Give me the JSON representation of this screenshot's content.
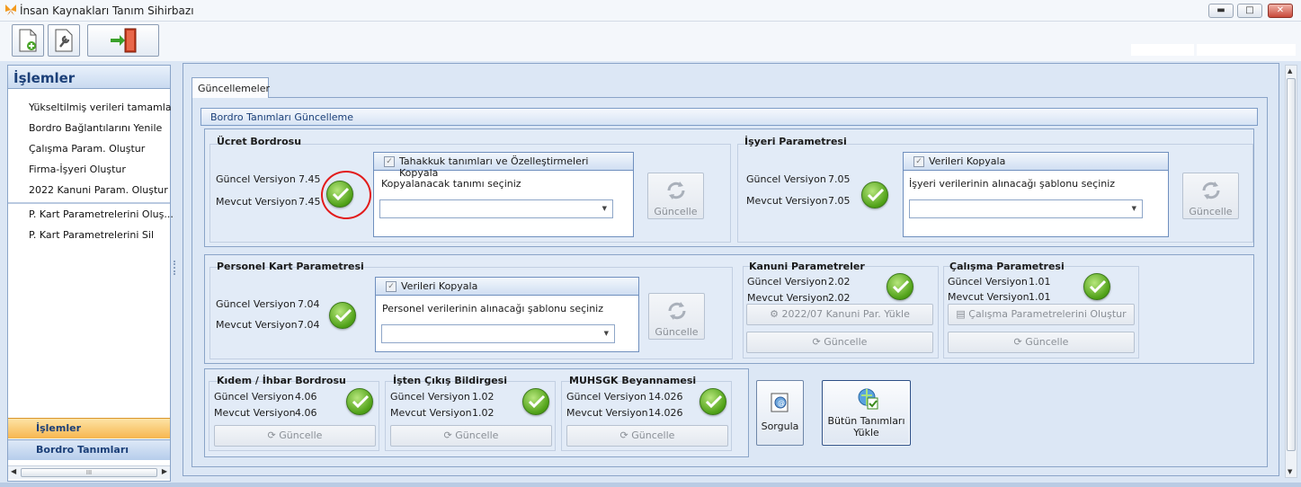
{
  "window": {
    "title": "İnsan Kaynakları Tanım Sihirbazı",
    "minimize": "▬",
    "maximize": "□",
    "close": "✕"
  },
  "toolbar": {
    "items": [
      "new-document-icon",
      "settings-wrench-icon",
      "exit-door-icon"
    ]
  },
  "sidebar": {
    "title": "İşlemler",
    "items": [
      "Yükseltilmiş verileri tamamla",
      "Bordro Bağlantılarını Yenile",
      "Çalışma Param. Oluştur",
      "Firma-İşyeri Oluştur",
      "2022 Kanuni Param. Oluştur"
    ],
    "items2": [
      "P. Kart Parametrelerini Oluş...",
      "P. Kart Parametrelerini Sil"
    ],
    "tab_active": "İşlemler",
    "tab_other": "Bordro Tanımları",
    "scroll_grip": "III"
  },
  "main": {
    "tab": "Güncellemeler",
    "group_title": "Bordro Tanımları Güncelleme",
    "ucret": {
      "title": "Ücret Bordrosu",
      "guncel_label": "Güncel Versiyon",
      "guncel": "7.45",
      "mevcut_label": "Mevcut Versiyon",
      "mevcut": "7.45",
      "copy_label": "Tahakkuk tanımları ve Özelleştirmeleri Kopyala",
      "select_label": "Kopyalanacak tanımı seçiniz",
      "button": "Güncelle"
    },
    "isyeri": {
      "title": "İşyeri Parametresi",
      "guncel_label": "Güncel Versiyon",
      "guncel": "7.05",
      "mevcut_label": "Mevcut Versiyon",
      "mevcut": "7.05",
      "copy_label": "Verileri Kopyala",
      "select_label": "İşyeri verilerinin alınacağı şablonu seçiniz",
      "button": "Güncelle"
    },
    "personel": {
      "title": "Personel Kart Parametresi",
      "guncel_label": "Güncel Versiyon",
      "guncel": "7.04",
      "mevcut_label": "Mevcut Versiyon",
      "mevcut": "7.04",
      "copy_label": "Verileri Kopyala",
      "select_label": "Personel verilerinin alınacağı şablonu seçiniz",
      "button": "Güncelle"
    },
    "kanuni": {
      "title": "Kanuni Parametreler",
      "guncel_label": "Güncel Versiyon",
      "guncel": "2.02",
      "mevcut_label": "Mevcut Versiyon",
      "mevcut": "2.02",
      "load_button": "2022/07 Kanuni Par. Yükle",
      "button": "Güncelle"
    },
    "calisma": {
      "title": "Çalışma Parametresi",
      "guncel_label": "Güncel Versiyon",
      "guncel": "1.01",
      "mevcut_label": "Mevcut Versiyon",
      "mevcut": "1.01",
      "create_button": "Çalışma Parametrelerini Oluştur",
      "button": "Güncelle"
    },
    "kidem": {
      "title": "Kıdem / İhbar Bordrosu",
      "guncel_label": "Güncel Versiyon",
      "guncel": "4.06",
      "mevcut_label": "Mevcut Versiyon",
      "mevcut": "4.06",
      "button": "Güncelle"
    },
    "isten": {
      "title": "İşten Çıkış Bildirgesi",
      "guncel_label": "Güncel Versiyon",
      "guncel": "1.02",
      "mevcut_label": "Mevcut Versiyon",
      "mevcut": "1.02",
      "button": "Güncelle"
    },
    "muhsgk": {
      "title": "MUHSGK Beyannamesi",
      "guncel_label": "Güncel Versiyon",
      "guncel": "14.026",
      "mevcut_label": "Mevcut Versiyon",
      "mevcut": "14.026",
      "button": "Güncelle"
    },
    "sorgula": "Sorgula",
    "butun_line1": "Bütün Tanımları",
    "butun_line2": "Yükle"
  },
  "colors": {
    "accent": "#1b3f78",
    "highlight": "#e21b1b",
    "ok": "#4ea016",
    "active_tab": "#f7b64f"
  }
}
